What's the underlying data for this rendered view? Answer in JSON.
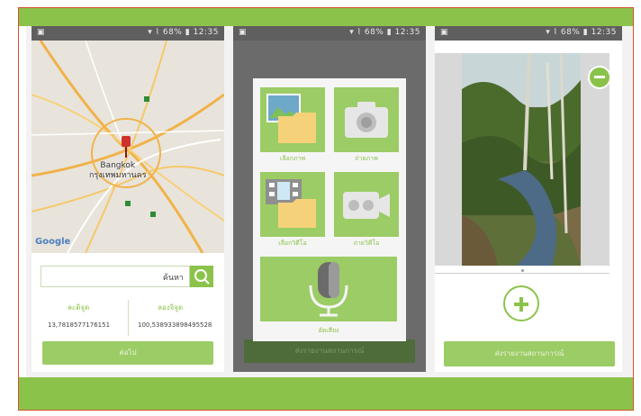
{
  "colors": {
    "accent": "#8bc34a",
    "accent_dark": "#4e6b3a",
    "status_bar": "#5f5f5f"
  },
  "status_bar": {
    "battery": "68%",
    "time": "12:35"
  },
  "screen_location": {
    "map_city_en": "Bangkok",
    "map_city_th": "กรุงเทพมหานคร",
    "map_provider": "Google",
    "search_placeholder": "ค้นหา",
    "latitude_label": "ละติจูด",
    "longitude_label": "ลองจิจูด",
    "latitude_value": "13,7818577176151",
    "longitude_value": "100,538933898495528",
    "next_button": "ต่อไป"
  },
  "screen_media": {
    "tiles": [
      {
        "icon": "image-folder-icon",
        "label": "เลือกภาพ"
      },
      {
        "icon": "camera-icon",
        "label": "ถ่ายภาพ"
      },
      {
        "icon": "video-folder-icon",
        "label": "เลือกวิดีโอ"
      },
      {
        "icon": "video-camera-icon",
        "label": "ถ่ายวิดีโอ"
      },
      {
        "icon": "microphone-icon",
        "label": "อัดเสียง"
      }
    ],
    "bottom_button": "ส่งรายงานสถานการณ์"
  },
  "screen_preview": {
    "bottom_button": "ส่งรายงานสถานการณ์"
  }
}
